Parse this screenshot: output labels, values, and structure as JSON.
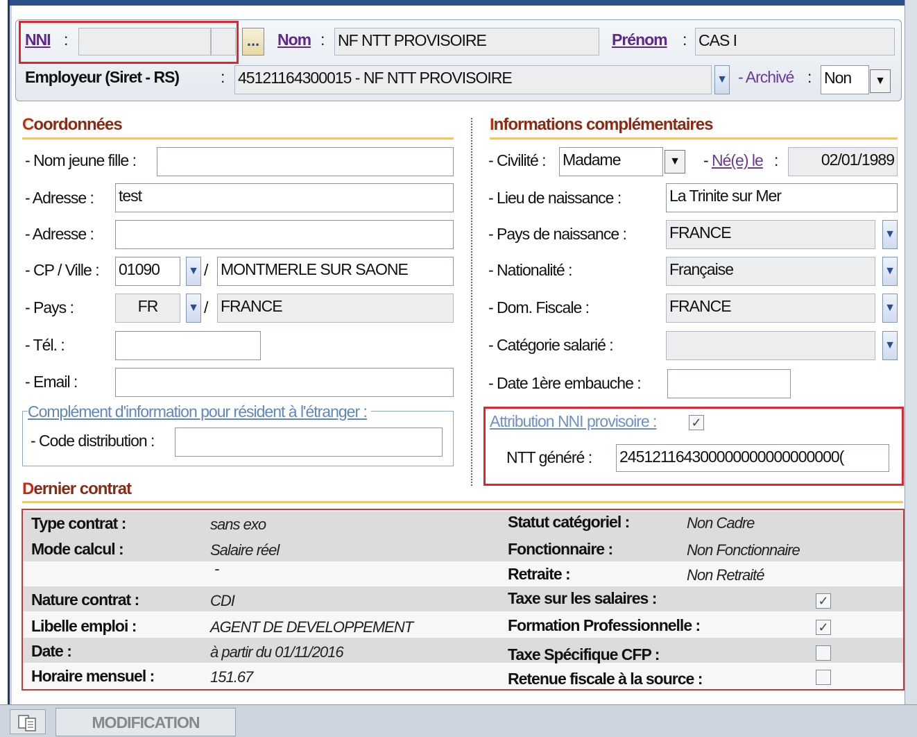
{
  "header": {
    "nni_label": "NNI",
    "nni_value": "",
    "nni_button": "...",
    "nom_label": "Nom",
    "nom_value": "NF NTT PROVISOIRE",
    "prenom_label": "Prénom",
    "prenom_value": "CAS I",
    "employeur_label": "Employeur (Siret - RS)",
    "employeur_value": "45121164300015 - NF NTT PROVISOIRE",
    "archive_label": "- Archivé",
    "archive_value": "Non",
    "colon": ":"
  },
  "coordonnees": {
    "title_first": "C",
    "title_rest": "oordonnées",
    "nom_jeune_fille_label": "- Nom jeune fille :",
    "nom_jeune_fille_value": "",
    "adresse1_label": "- Adresse :",
    "adresse1_value": "test",
    "adresse2_label": "- Adresse :",
    "adresse2_value": "",
    "cp_ville_label": "- CP / Ville :",
    "cp_value": "01090",
    "ville_value": "MONTMERLE SUR SAONE",
    "pays_label": "- Pays :",
    "pays_code": "FR",
    "pays_value": "FRANCE",
    "tel_label": "- Tél. :",
    "tel_value": "",
    "email_label": "- Email :",
    "email_value": "",
    "slash": "/",
    "etranger_legend": "Complément d'information pour résident à l'étranger :",
    "code_distribution_label": "- Code distribution :",
    "code_distribution_value": ""
  },
  "infos": {
    "title_first": "I",
    "title_rest": "nformations complémentaires",
    "civilite_label": "- Civilité :",
    "civilite_value": "Madame",
    "ne_le_prefix": "-",
    "ne_le_label": "Né(e) le",
    "ne_le_value": "02/01/1989",
    "lieu_naissance_label": "- Lieu de naissance :",
    "lieu_naissance_value": "La Trinite sur Mer",
    "pays_naissance_label": "- Pays de naissance :",
    "pays_naissance_value": "FRANCE",
    "nationalite_label": "- Nationalité :",
    "nationalite_value": "Française",
    "dom_fiscale_label": "- Dom. Fiscale :",
    "dom_fiscale_value": "FRANCE",
    "categorie_label": "- Catégorie salarié :",
    "categorie_value": "",
    "date_embauche_label": "- Date 1ère embauche :",
    "date_embauche_value": "",
    "attribution_label": "Attribution NNI provisoire :",
    "attribution_checked": true,
    "ntt_label": "NTT généré :",
    "ntt_value": "245121164300000000000000000("
  },
  "dernier_contrat": {
    "title_first": "D",
    "title_rest": "ernier contrat",
    "left_rows": [
      {
        "label": "Type contrat :",
        "value": "sans exo"
      },
      {
        "label": "Mode calcul :",
        "value": "Salaire réel"
      },
      {
        "label": "",
        "value": "-"
      },
      {
        "label": "Nature contrat :",
        "value": "CDI"
      },
      {
        "label": "Libelle emploi :",
        "value": "AGENT DE DEVELOPPEMENT"
      },
      {
        "label": "Date :",
        "value": "à partir du 01/11/2016"
      },
      {
        "label": "Horaire mensuel :",
        "value": "151.67"
      }
    ],
    "right_rows": [
      {
        "label": "Statut catégoriel :",
        "value": "Non Cadre"
      },
      {
        "label": "Fonctionnaire :",
        "value": "Non Fonctionnaire"
      },
      {
        "label": "Retraite :",
        "value": "Non Retraité"
      },
      {
        "label": "Taxe sur les salaires :",
        "checked": true
      },
      {
        "label": "Formation Professionnelle :",
        "checked": true
      },
      {
        "label": "Taxe Spécifique CFP :",
        "checked": false
      },
      {
        "label": "Retenue fiscale à la source :",
        "checked": false
      }
    ]
  },
  "statusbar": {
    "mode_label": "MODIFICATION",
    "icon": "document-icon"
  },
  "colors": {
    "accent_red": "#e0262c",
    "section_underline": "#f3c46e",
    "link_purple": "#5b2a8a"
  }
}
